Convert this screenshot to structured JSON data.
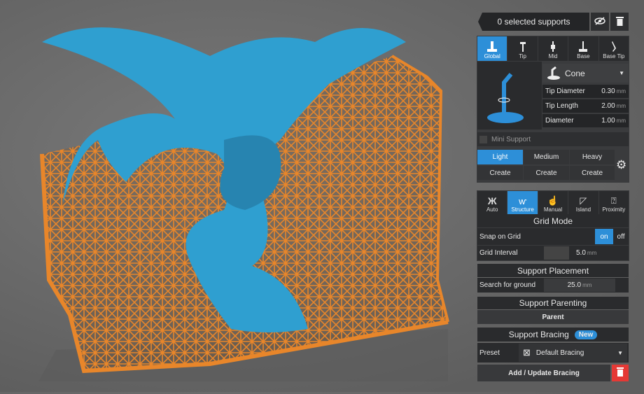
{
  "header": {
    "title": "0 selected supports",
    "visibility_icon": "eye-off-icon",
    "delete_icon": "trash-icon"
  },
  "support_tabs": [
    {
      "label": "Global",
      "active": true
    },
    {
      "label": "Tip"
    },
    {
      "label": "Mid"
    },
    {
      "label": "Base"
    },
    {
      "label": "Base Tip"
    }
  ],
  "support_type": {
    "selected": "Cone"
  },
  "fields": [
    {
      "label": "Tip Diameter",
      "value": "0.30",
      "unit": "mm"
    },
    {
      "label": "Tip Length",
      "value": "2.00",
      "unit": "mm"
    },
    {
      "label": "Diameter",
      "value": "1.00",
      "unit": "mm"
    }
  ],
  "mini_support": {
    "label": "Mini Support",
    "checked": false
  },
  "presets": [
    {
      "label": "Light",
      "action": "Create",
      "active": true
    },
    {
      "label": "Medium",
      "action": "Create"
    },
    {
      "label": "Heavy",
      "action": "Create"
    }
  ],
  "mode_tabs": [
    {
      "label": "Auto"
    },
    {
      "label": "Structure",
      "active": true
    },
    {
      "label": "Manual"
    },
    {
      "label": "Island"
    },
    {
      "label": "Proximity"
    }
  ],
  "grid_mode": {
    "title": "Grid Mode",
    "snap_label": "Snap on Grid",
    "on": "on",
    "off": "off",
    "interval_label": "Grid Interval",
    "interval_value": "5.0",
    "unit": "mm"
  },
  "placement": {
    "title": "Support Placement",
    "search_label": "Search for ground",
    "search_value": "25.0",
    "unit": "mm"
  },
  "parenting": {
    "title": "Support Parenting",
    "button": "Parent"
  },
  "bracing": {
    "title": "Support Bracing",
    "badge": "New",
    "preset_label": "Preset",
    "preset_value": "Default Bracing",
    "button": "Add / Update Bracing"
  },
  "colors": {
    "accent": "#2d8fd8",
    "support": "#e8862a",
    "model": "#2f9fd0",
    "danger": "#e53935"
  }
}
